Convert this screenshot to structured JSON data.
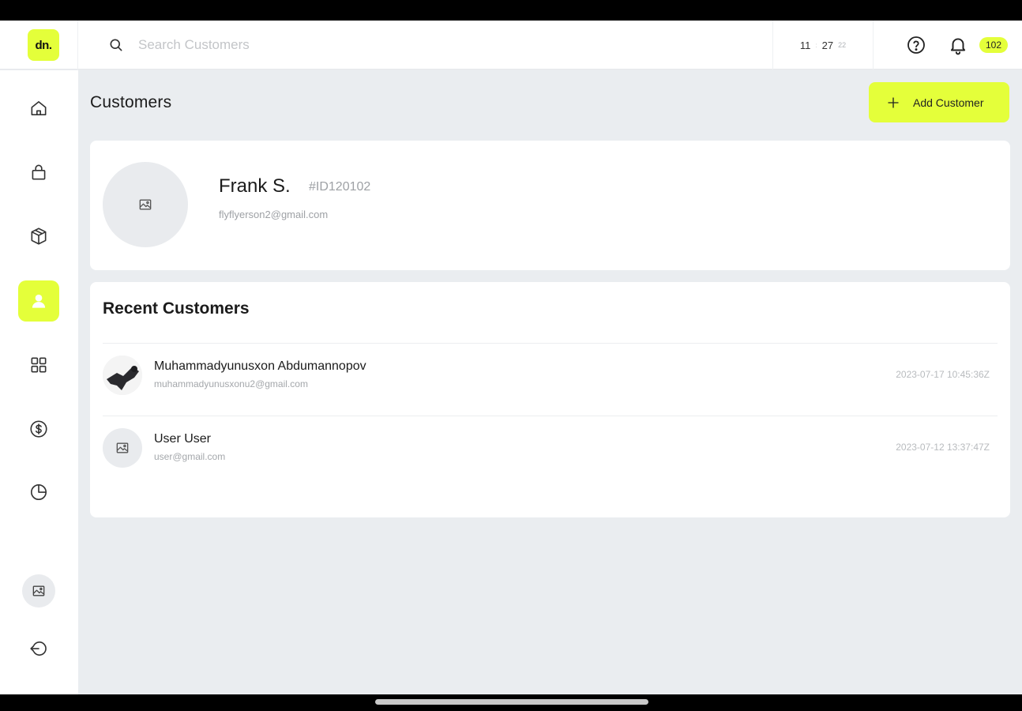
{
  "header": {
    "logo_text": "dn.",
    "search_placeholder": "Search Customers",
    "clock": {
      "hours": "11",
      "minutes": "27",
      "seconds": "22"
    },
    "notification_count": "102"
  },
  "sidebar": {
    "items": [
      {
        "name": "home-icon",
        "active": false
      },
      {
        "name": "bag-icon",
        "active": false
      },
      {
        "name": "box-icon",
        "active": false
      },
      {
        "name": "user-icon",
        "active": true
      },
      {
        "name": "grid-icon",
        "active": false
      },
      {
        "name": "dollar-icon",
        "active": false
      },
      {
        "name": "pie-chart-icon",
        "active": false
      }
    ],
    "bottom": [
      "avatar-placeholder-icon",
      "logout-icon"
    ]
  },
  "page": {
    "title": "Customers",
    "add_button_label": "Add Customer"
  },
  "profile": {
    "name": "Frank S.",
    "id": "#ID120102",
    "email": "flyflyerson2@gmail.com"
  },
  "recent": {
    "title": "Recent Customers",
    "rows": [
      {
        "name": "Muhammadyunusxon Abdumannopov",
        "email": "muhammadyunusxonu2@gmail.com",
        "time": "2023-07-17 10:45:36Z",
        "has_photo": true
      },
      {
        "name": "User User",
        "email": "user@gmail.com",
        "time": "2023-07-12 13:37:47Z",
        "has_photo": false
      }
    ]
  },
  "colors": {
    "accent": "#e4ff3a",
    "background": "#eaedf0",
    "card": "#ffffff"
  }
}
